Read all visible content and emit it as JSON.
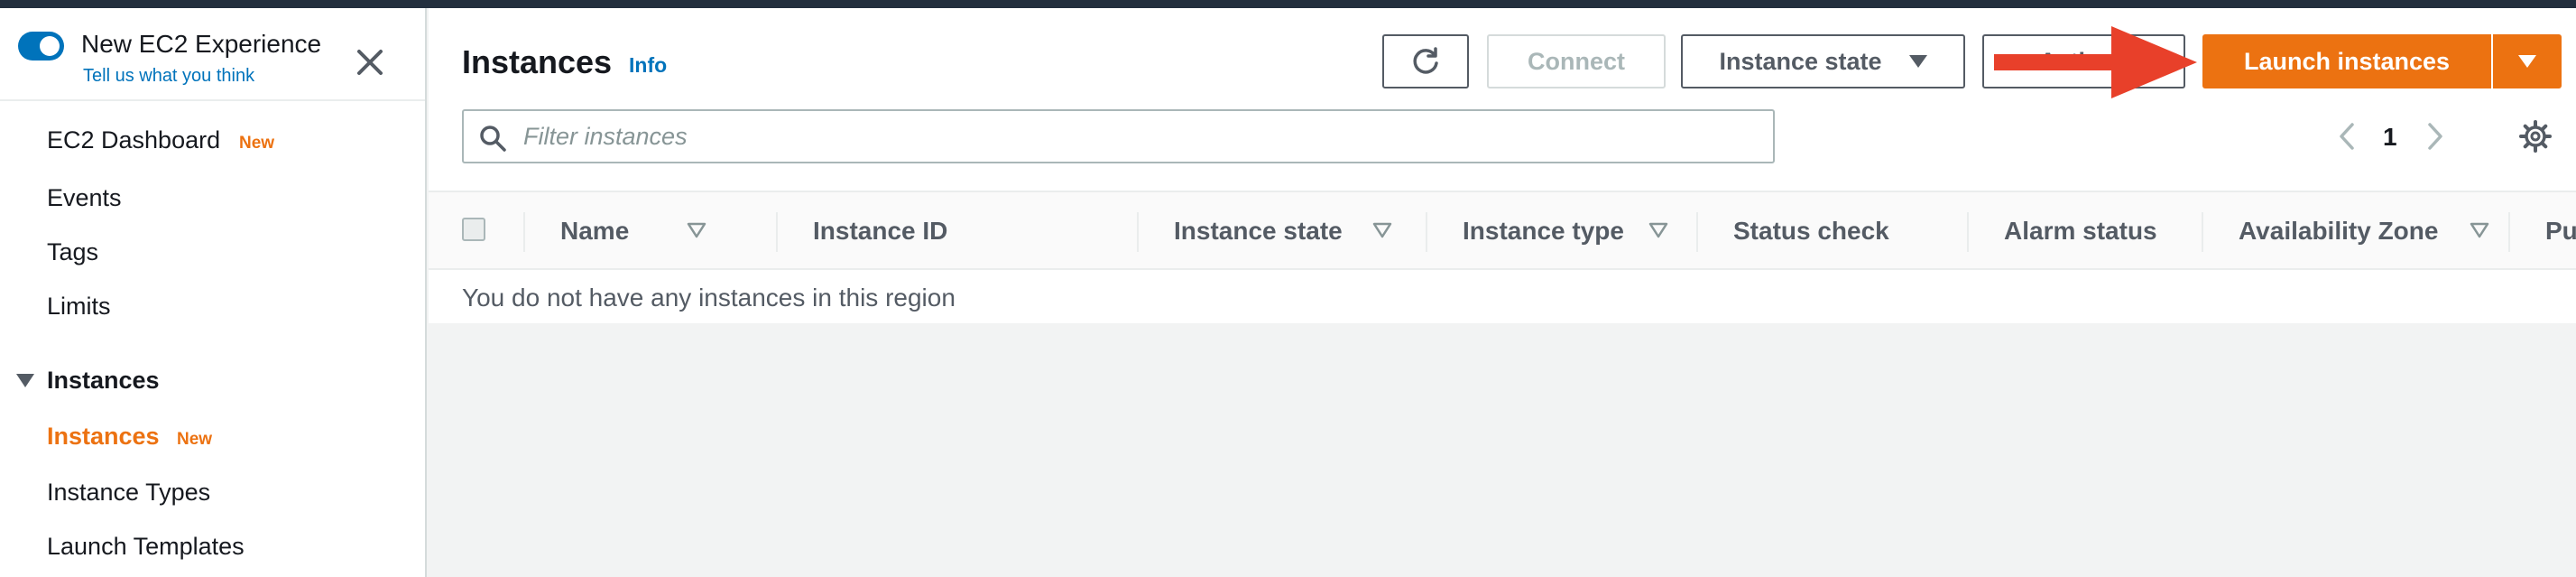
{
  "experience": {
    "title": "New EC2 Experience",
    "subtitle": "Tell us what you think",
    "toggle_on": true
  },
  "sidebar": {
    "items": [
      {
        "label": "EC2 Dashboard",
        "badge": "New"
      },
      {
        "label": "Events"
      },
      {
        "label": "Tags"
      },
      {
        "label": "Limits"
      }
    ],
    "section": {
      "label": "Instances",
      "items": [
        {
          "label": "Instances",
          "badge": "New",
          "active": true
        },
        {
          "label": "Instance Types"
        },
        {
          "label": "Launch Templates"
        }
      ]
    }
  },
  "header": {
    "title": "Instances",
    "info": "Info"
  },
  "toolbar": {
    "connect": "Connect",
    "instance_state": "Instance state",
    "actions": "Actions",
    "launch": "Launch instances"
  },
  "filter": {
    "placeholder": "Filter instances"
  },
  "pagination": {
    "page": "1"
  },
  "table": {
    "columns": [
      {
        "label": "Name",
        "sortable": true
      },
      {
        "label": "Instance ID",
        "sortable": false
      },
      {
        "label": "Instance state",
        "sortable": true
      },
      {
        "label": "Instance type",
        "sortable": true
      },
      {
        "label": "Status check",
        "sortable": false
      },
      {
        "label": "Alarm status",
        "sortable": false
      },
      {
        "label": "Availability Zone",
        "sortable": true
      },
      {
        "label": "Pu",
        "sortable": false
      }
    ],
    "empty_message": "You do not have any instances in this region"
  },
  "colors": {
    "accent": "#ec7211",
    "link": "#0073bb",
    "annotation_arrow": "#e8402a"
  },
  "icons": {
    "close": "close-icon",
    "refresh": "refresh-icon",
    "search": "search-icon",
    "settings": "gear-icon"
  }
}
